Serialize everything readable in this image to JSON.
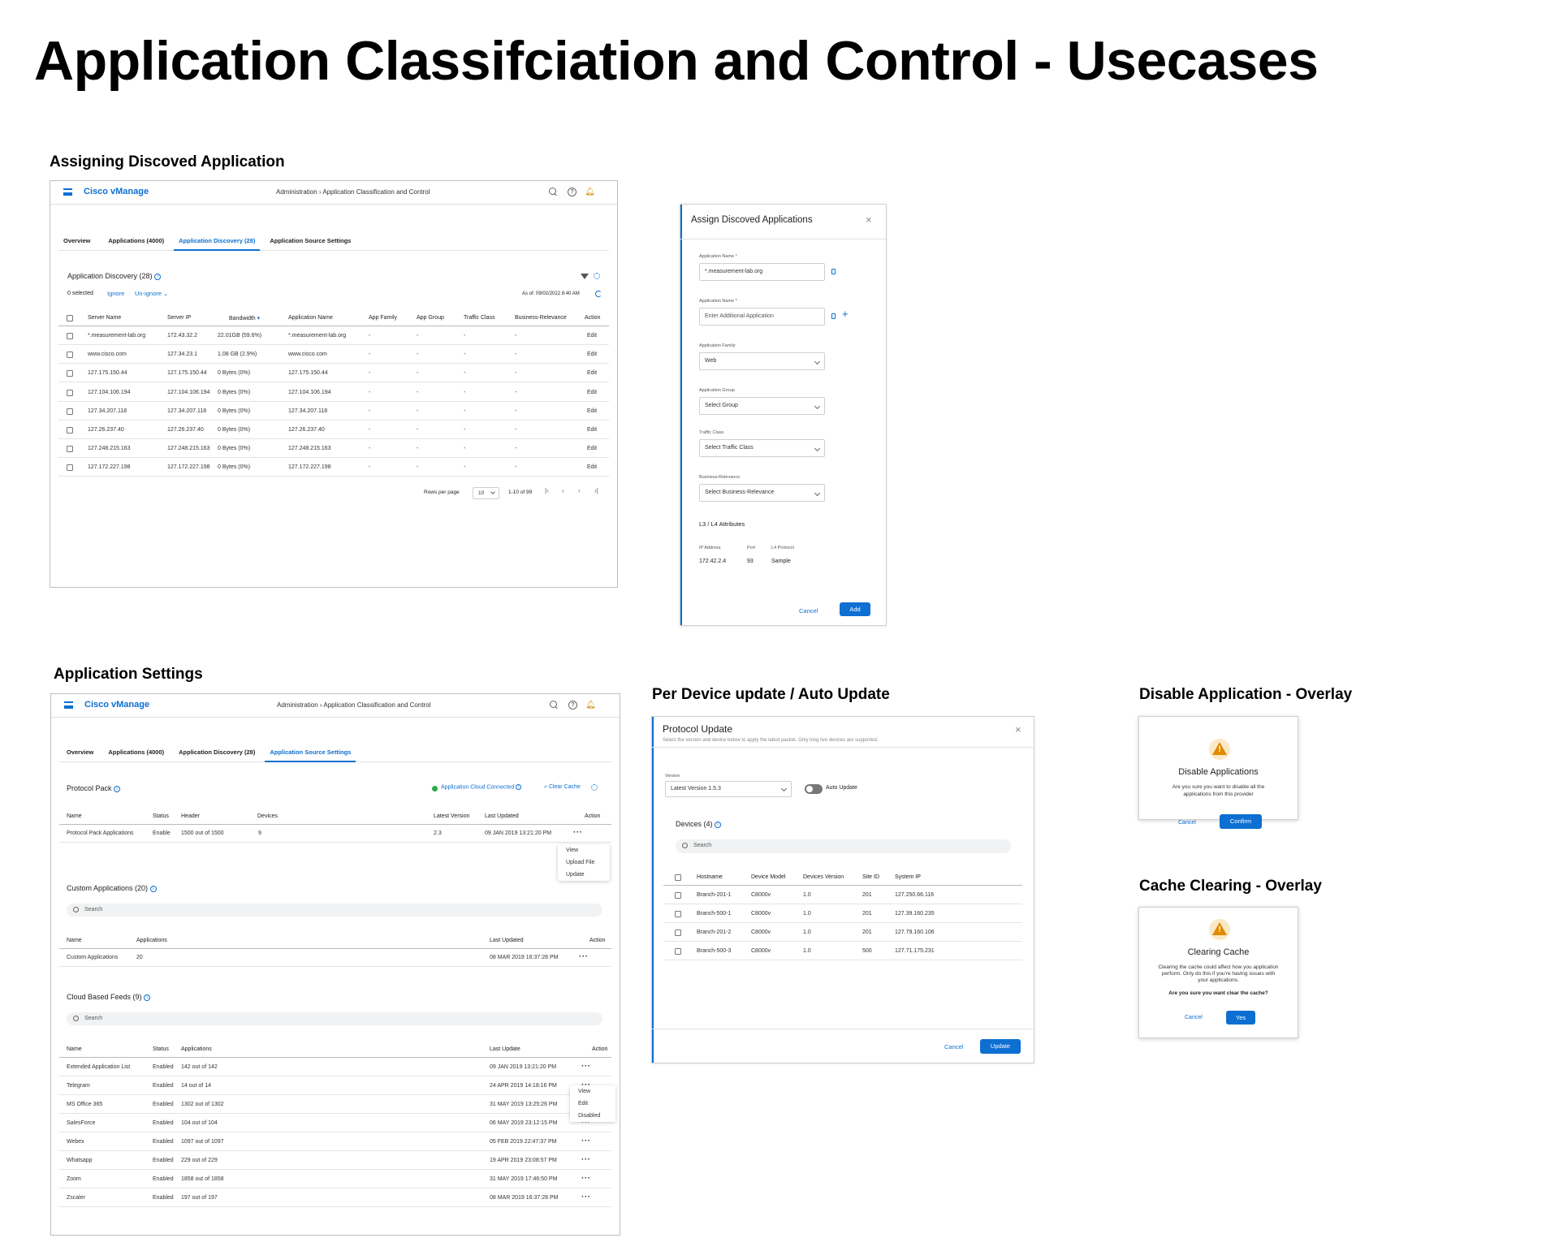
{
  "page_title": "Application Classifciation and Control - Usecases",
  "sections": {
    "assign": "Assigning Discoved Application",
    "settings": "Application Settings",
    "per_device": "Per Device update / Auto Update",
    "disable": "Disable Application - Overlay",
    "cache": "Cache Clearing - Overlay"
  },
  "app": {
    "brand": "Cisco vManage",
    "breadcrumb_root": "Administration",
    "breadcrumb_sep": " › ",
    "breadcrumb_page": "Application Classification and Control",
    "tabs": [
      "Overview",
      "Applications (4000)",
      "Application Discovery (28)",
      "Application Source Settings"
    ]
  },
  "discovery": {
    "title": "Application Discovery (28)",
    "selected": "0 selected",
    "ignore": "Ignore",
    "unignore": "Un-ignore",
    "as_of": "As of: 09/02/2022 8:40 AM",
    "columns": [
      "Server Name",
      "Server IP",
      "Bandwidth",
      "Application Name",
      "App Family",
      "App Group",
      "Traffic Class",
      "Business-Relevance",
      "Action"
    ],
    "rows": [
      [
        "*.measurement-lab.org",
        "172.43.32.2",
        "22.01GB (59.6%)",
        "*.measurement-lab.org",
        "-",
        "-",
        "-",
        "-",
        "Edit"
      ],
      [
        "www.cisco.com",
        "127.34.23.1",
        "1.08 GB (2.9%)",
        "www.cisco.com",
        "-",
        "-",
        "-",
        "-",
        "Edit"
      ],
      [
        "127.175.150.44",
        "127.175.150.44",
        "0 Bytes (0%)",
        "127.175.150.44",
        "-",
        "-",
        "-",
        "-",
        "Edit"
      ],
      [
        "127.104.106.194",
        "127.104.106.194",
        "0 Bytes (0%)",
        "127.104.106.194",
        "-",
        "-",
        "-",
        "-",
        "Edit"
      ],
      [
        "127.34.207.118",
        "127.34.207.118",
        "0 Bytes (0%)",
        "127.34.207.118",
        "-",
        "-",
        "-",
        "-",
        "Edit"
      ],
      [
        "127.26.237.40",
        "127.26.237.40",
        "0 Bytes (0%)",
        "127.26.237.40",
        "-",
        "-",
        "-",
        "-",
        "Edit"
      ],
      [
        "127.248.215.163",
        "127.248.215.163",
        "0 Bytes (0%)",
        "127.248.215.163",
        "-",
        "-",
        "-",
        "-",
        "Edit"
      ],
      [
        "127.172.227.198",
        "127.172.227.198",
        "0 Bytes (0%)",
        "127.172.227.198",
        "-",
        "-",
        "-",
        "-",
        "Edit"
      ]
    ],
    "rows_per_page_label": "Rows per page",
    "rows_per_page": "10",
    "range": "1-10 of 99"
  },
  "assign_modal": {
    "title": "Assign Discoved Applications",
    "app_name_label": "Application Name *",
    "app_name_value": "*.measurement-lab.org",
    "app_name2_label": "Application Name *",
    "app_name2_placeholder": "Enter Additional Application",
    "family_label": "Application Family",
    "family_value": "Web",
    "group_label": "Application Group",
    "group_value": "Select Group",
    "traffic_label": "Traffic Class",
    "traffic_value": "Select Traffic Class",
    "business_label": "Business-Relevance",
    "business_value": "Select Business-Relevance",
    "l3_title": "L3 / L4 Attributes",
    "ip_label": "IP Address",
    "port_label": "Port",
    "proto_label": "L4 Protocol",
    "ip_value": "172.42.2.4",
    "port_value": "93",
    "proto_value": "Sample",
    "cancel": "Cancel",
    "add": "Add"
  },
  "settings": {
    "protocol_pack_title": "Protocol Pack",
    "cloud_connected": "Application Cloud Connected",
    "clear_cache": "Clear Cache",
    "pp_columns": [
      "Name",
      "Status",
      "Header",
      "Devices",
      "Latest Version",
      "Last Updated",
      "Action"
    ],
    "pp_row": [
      "Protocol Pack Applications",
      "Enable",
      "1500 out of 1500",
      "9",
      "2.3",
      "09  JAN 2019 13:21:20 PM"
    ],
    "pp_menu": [
      "View",
      "Upload File",
      "Update"
    ],
    "custom_title": "Custom Applications (20)",
    "search": "Search",
    "custom_columns": [
      "Name",
      "Applications",
      "Last Updated",
      "Action"
    ],
    "custom_row": [
      "Custom Applications",
      "20",
      "08  MAR 2019 16:37:28 PM"
    ],
    "feeds_title": "Cloud Based Feeds (9)",
    "feeds_columns": [
      "Name",
      "Status",
      "Applications",
      "Last Update",
      "Action"
    ],
    "feeds_rows": [
      [
        "Extended Application List",
        "Enabled",
        "142 out of 142",
        "09  JAN 2019 13:21:20 PM"
      ],
      [
        "Telegram",
        "Enabled",
        "14 out of 14",
        "24  APR 2019 14:18:16 PM"
      ],
      [
        "MS Office 365",
        "Enabled",
        "1302 out of 1302",
        "31  MAY 2019 13:25:26 PM"
      ],
      [
        "SalesForce",
        "Enabled",
        "104 out of 104",
        "06  MAY 2019 23:12:15 PM"
      ],
      [
        "Webex",
        "Enabled",
        "1097 out of 1097",
        "05  FEB 2019 22:47:37 PM"
      ],
      [
        "Whatsapp",
        "Enabled",
        "229 out of 229",
        "19  APR 2019 23:08:57 PM"
      ],
      [
        "Zoom",
        "Enabled",
        "1858 out of 1858",
        "31  MAY 2019 17:46:50 PM"
      ],
      [
        "Zscaler",
        "Enabled",
        "197 out of 197",
        "08  MAR 2019 16:37:28 PM"
      ]
    ],
    "feeds_menu": [
      "View",
      "Edit",
      "Disabled"
    ]
  },
  "protocol_update": {
    "title": "Protocol Update",
    "subtitle": "Select the version and device below to apply the latest packet.  Only long live devices are supported.",
    "version_label": "Version",
    "version_value": "Latest Version 1.5.3",
    "auto_update": "Auto Update",
    "devices_title": "Devices (4)",
    "search": "Search",
    "columns": [
      "Hostname",
      "Device Model",
      "Devices Version",
      "Site ID",
      "System IP"
    ],
    "rows": [
      [
        "Branch-201-1",
        "C8000v",
        "1.0",
        "201",
        "127.250.66.116"
      ],
      [
        "Branch-500-1",
        "C8000v",
        "1.0",
        "201",
        "127.39.160.235"
      ],
      [
        "Branch-201-2",
        "C8000v",
        "1.0",
        "201",
        "127.79.160.106"
      ],
      [
        "Branch-500-3",
        "C8000v",
        "1.0",
        "500",
        "127.71.175.231"
      ]
    ],
    "cancel": "Cancel",
    "update": "Update"
  },
  "disable_overlay": {
    "title": "Disable Applications",
    "body": "Are you sure you want to disable all the applications from this provider",
    "cancel": "Cancel",
    "confirm": "Confirm"
  },
  "cache_overlay": {
    "title": "Clearing Cache",
    "body": "Clearing the cache could affect how you application perform.  Only do this if you're having issues with your applications.",
    "question": "Are you sure you want clear the cache?",
    "cancel": "Cancel",
    "yes": "Yes"
  },
  "colors": {
    "primary": "#0d6fd1",
    "warning": "#e08a00",
    "success": "#2ba84a"
  }
}
